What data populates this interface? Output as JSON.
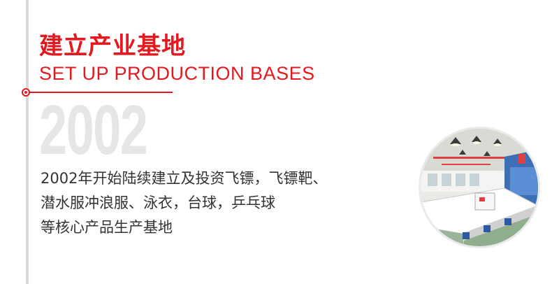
{
  "section": {
    "title_cn": "建立产业基地",
    "title_en": "SET UP PRODUCTION BASES",
    "year": "2002",
    "description_lines": [
      "2002年开始陆续建立及投资飞镖，飞镖靶、",
      "潜水服冲浪服、泳衣，台球，乒乓球",
      "等核心产品生产基地"
    ]
  },
  "colors": {
    "accent": "#e4191f",
    "year_watermark": "#e6e6e6",
    "text": "#333333",
    "timeline": "#d9d9d9"
  }
}
